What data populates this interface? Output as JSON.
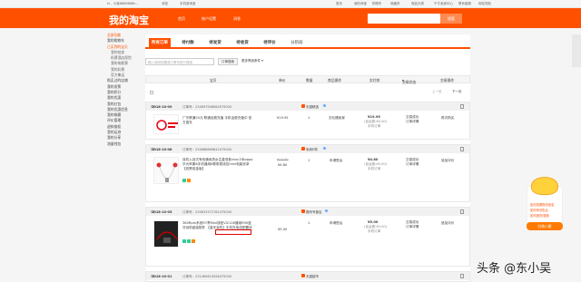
{
  "topbar": {
    "items": [
      "hi，小吴6666666h...",
      "消息",
      "手机逛淘宝",
      "首页",
      "我的淘宝",
      "购物车",
      "收藏夹",
      "商品分类",
      "千牛卖家中心",
      "联系客服",
      "网站导航"
    ]
  },
  "header": {
    "logo": "我的淘宝",
    "nav": [
      "首页",
      "账户设置",
      "消息"
    ],
    "search_button": "搜索"
  },
  "sidebar": {
    "items": [
      {
        "label": "全部功能",
        "type": "t"
      },
      {
        "label": "我的购物车",
        "type": ""
      },
      {
        "label": "已买到的宝贝",
        "type": "a"
      },
      {
        "label": "我的拍卖",
        "type": "i"
      },
      {
        "label": "机票酒店保险",
        "type": "i"
      },
      {
        "label": "我的电影票",
        "type": "i"
      },
      {
        "label": "我的彩票",
        "type": "i"
      },
      {
        "label": "官方集运",
        "type": "i"
      },
      {
        "label": "购买过的店铺",
        "type": ""
      },
      {
        "label": "我的发票",
        "type": ""
      },
      {
        "label": "我的积分",
        "type": ""
      },
      {
        "label": "我的优惠",
        "type": ""
      },
      {
        "label": "我的红包",
        "type": ""
      },
      {
        "label": "我的优惠信息",
        "type": ""
      },
      {
        "label": "我的收藏",
        "type": ""
      },
      {
        "label": "评价管理",
        "type": ""
      },
      {
        "label": "退款维权",
        "type": ""
      },
      {
        "label": "我的足迹",
        "type": ""
      },
      {
        "label": "我的分享",
        "type": ""
      },
      {
        "label": "流量钱包",
        "type": ""
      }
    ]
  },
  "tabs": [
    "所有订单",
    "待付款",
    "待发货",
    "待收货",
    "待评价",
    "分阶段"
  ],
  "filters": {
    "placeholder": "输入商品标题或订单号进行搜索",
    "button": "订单搜索",
    "more": "更多筛选条件"
  },
  "columns": [
    "宝贝",
    "单价",
    "数量",
    "商品操作",
    "实付款",
    "交易状态",
    "交易操作"
  ],
  "pager": {
    "prev": "上一页",
    "next": "下一页"
  },
  "orders": [
    {
      "date": "2018-10-09",
      "num": "订单号：234697506984975000",
      "shop": "天猫精选",
      "title": "广东联通20元 联通话费充值 手机话费充值中 官方直充",
      "price": "¥19.95",
      "qty": "1",
      "op": "去吐槽卖家",
      "paid": "¥19.95",
      "paid_note": "(含运费:¥0.00)",
      "paid_sub": "手机订单",
      "status": "交易成功",
      "status_sub": "订单详情",
      "action": "再次购买"
    },
    {
      "date": "2018-10-08",
      "num": "订单号：234688869842475000",
      "shop": "电商E购",
      "title": "耳机入耳式有线通用男女生重低音vivo小米oppo华为苹果6手机通用K歌带麦线控mini电脑安卓【炫黑铂金版】",
      "price_old": "¥13.00",
      "price": "¥4.80",
      "qty": "1",
      "op": "申请售后",
      "paid": "¥4.80",
      "paid_note": "(含运费:¥0.00)",
      "paid_sub": "手机订单",
      "status": "交易成功",
      "status_sub": "订单详情",
      "action": "追加评价"
    },
    {
      "date": "2018-10-05",
      "num": "订单号：234633371782475000",
      "shop": "数码专营店",
      "title": "360Rpm系统R7青Mini按钮VI2128通用R9S蓝牙耳机链接配件 【蓝牙耳机】手机充电线配置线",
      "price": "¥5.00",
      "qty": "1",
      "op": "申请售后",
      "paid": "¥5.00",
      "paid_note": "(含运费:¥0.00)",
      "paid_sub": "手机订单",
      "status": "交易成功",
      "status_sub": "订单详情",
      "action": "追加评价"
    },
    {
      "date": "2018-10-01",
      "num": "订单号：231460610058475000",
      "shop": "天猫超市"
    }
  ],
  "cs": {
    "lines": [
      "如何查看物流信息",
      "如何申请售后",
      "如何退货/退款"
    ],
    "button": "召唤小蜜"
  },
  "watermark": "头条 @东小吴",
  "colors": {
    "accent": "#ff5000"
  }
}
